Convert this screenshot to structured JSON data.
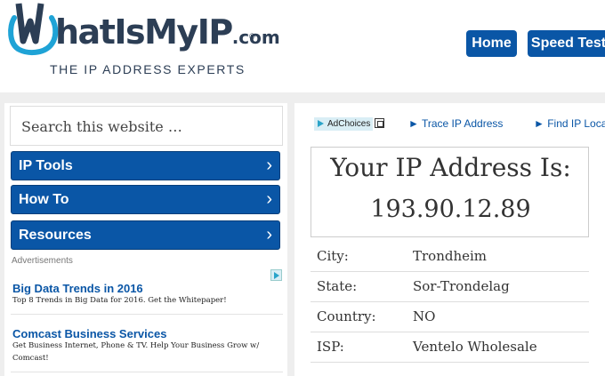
{
  "header": {
    "logo_main": "hatIsMyIP",
    "logo_suffix": ".com",
    "logo_reg": "®",
    "tagline": "THE IP ADDRESS EXPERTS",
    "nav": {
      "home": "Home",
      "speed_test": "Speed Test"
    }
  },
  "sidebar": {
    "search_placeholder": "Search this website …",
    "menu": [
      {
        "label": "IP Tools"
      },
      {
        "label": "How To"
      },
      {
        "label": "Resources"
      }
    ],
    "ads_label": "Advertisements",
    "ads": [
      {
        "title": "Big Data Trends in 2016",
        "description": "Top 8 Trends in Big Data for 2016. Get the Whitepaper!"
      },
      {
        "title": "Comcast Business Services",
        "description": "Get Business Internet, Phone & TV. Help Your Business Grow w/ Comcast!"
      }
    ]
  },
  "content": {
    "adchoices": "AdChoices",
    "links": {
      "trace": "► Trace IP Address",
      "find": "► Find IP Loca"
    },
    "ip_heading": "Your IP Address Is:",
    "ip_address": "193.90.12.89",
    "details": [
      {
        "key": "City:",
        "value": "Trondheim"
      },
      {
        "key": "State:",
        "value": "Sor-Trondelag"
      },
      {
        "key": "Country:",
        "value": "NO"
      },
      {
        "key": "ISP:",
        "value": "Ventelo Wholesale"
      }
    ]
  },
  "colors": {
    "brand_blue": "#0a56a6",
    "logo_dark": "#2c3e55",
    "logo_cyan": "#1fa3d6"
  }
}
